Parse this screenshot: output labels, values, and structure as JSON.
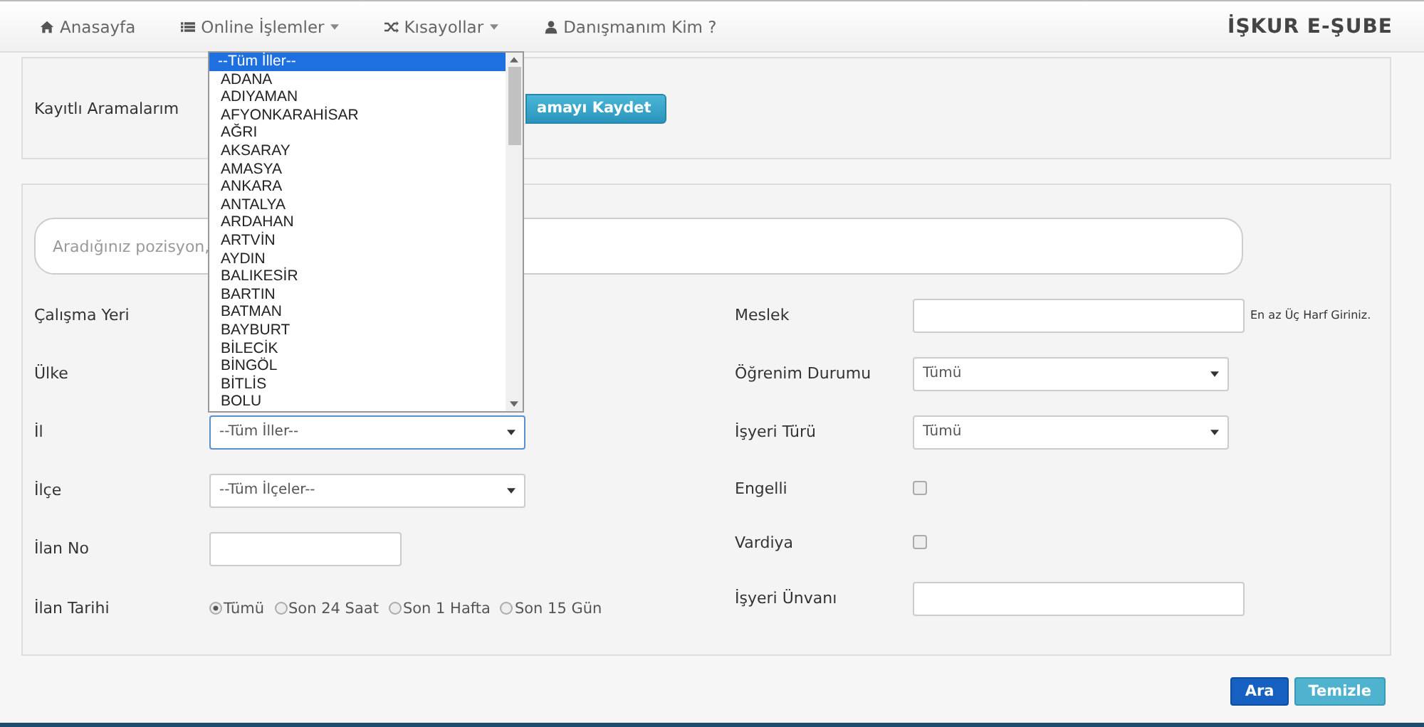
{
  "nav": {
    "items": [
      {
        "label": "Anasayfa",
        "dropdown": false
      },
      {
        "label": "Online İşlemler",
        "dropdown": true
      },
      {
        "label": "Kısayollar",
        "dropdown": true
      },
      {
        "label": "Danışmanım Kim ?",
        "dropdown": false
      }
    ],
    "brand": "İŞKUR E-ŞUBE"
  },
  "saved": {
    "label": "Kayıtlı Aramalarım",
    "button": "amayı Kaydet"
  },
  "search": {
    "placeholder": "Aradığınız pozisyon,"
  },
  "left_fields": [
    {
      "label": "Çalışma Yeri",
      "kind": "hidden"
    },
    {
      "label": "Ülke",
      "kind": "hidden"
    },
    {
      "label": "İl",
      "kind": "select",
      "value": "--Tüm İller--",
      "focused": true
    },
    {
      "label": "İlçe",
      "kind": "select",
      "value": "--Tüm İlçeler--",
      "focused": false
    },
    {
      "label": "İlan No",
      "kind": "input"
    },
    {
      "label": "İlan Tarihi",
      "kind": "radio",
      "options": [
        {
          "label": "Tümü",
          "selected": true
        },
        {
          "label": "Son 24 Saat",
          "selected": false
        },
        {
          "label": "Son 1 Hafta",
          "selected": false
        },
        {
          "label": "Son 15 Gün",
          "selected": false
        }
      ]
    }
  ],
  "right_fields": [
    {
      "label": "Meslek",
      "kind": "input",
      "hint": "En az Üç Harf Giriniz."
    },
    {
      "label": "Öğrenim Durumu",
      "kind": "select",
      "value": "Tümü"
    },
    {
      "label": "İşyeri Türü",
      "kind": "select",
      "value": "Tümü"
    },
    {
      "label": "Engelli",
      "kind": "checkbox",
      "checked": false
    },
    {
      "label": "Vardiya",
      "kind": "checkbox",
      "checked": false
    },
    {
      "label": "İşyeri Ünvanı",
      "kind": "input"
    }
  ],
  "il_dropdown": {
    "options": [
      {
        "label": "--Tüm İller--",
        "selected": true
      },
      {
        "label": "ADANA",
        "selected": false
      },
      {
        "label": "ADIYAMAN",
        "selected": false
      },
      {
        "label": "AFYONKARAHİSAR",
        "selected": false
      },
      {
        "label": "AĞRI",
        "selected": false
      },
      {
        "label": "AKSARAY",
        "selected": false
      },
      {
        "label": "AMASYA",
        "selected": false
      },
      {
        "label": "ANKARA",
        "selected": false
      },
      {
        "label": "ANTALYA",
        "selected": false
      },
      {
        "label": "ARDAHAN",
        "selected": false
      },
      {
        "label": "ARTVİN",
        "selected": false
      },
      {
        "label": "AYDIN",
        "selected": false
      },
      {
        "label": "BALIKESİR",
        "selected": false
      },
      {
        "label": "BARTIN",
        "selected": false
      },
      {
        "label": "BATMAN",
        "selected": false
      },
      {
        "label": "BAYBURT",
        "selected": false
      },
      {
        "label": "BİLECİK",
        "selected": false
      },
      {
        "label": "BİNGÖL",
        "selected": false
      },
      {
        "label": "BİTLİS",
        "selected": false
      },
      {
        "label": "BOLU",
        "selected": false
      }
    ]
  },
  "actions": [
    {
      "label": "Ara",
      "kind": "primary"
    },
    {
      "label": "Temizle",
      "kind": "info"
    }
  ]
}
